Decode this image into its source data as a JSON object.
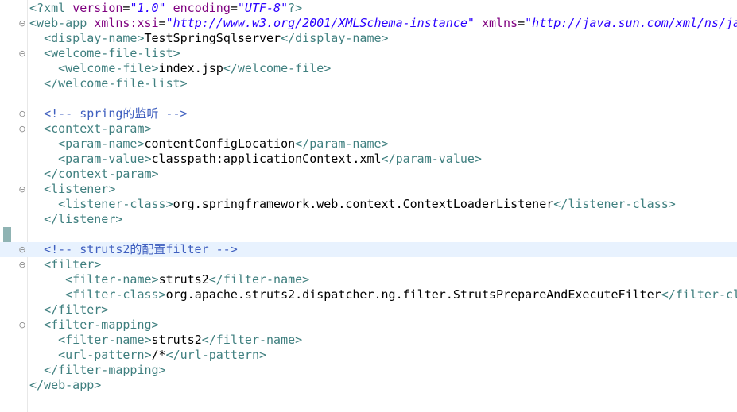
{
  "editor": {
    "lines": [
      [
        [
          "tag",
          "<?xml "
        ],
        [
          "attr",
          "version"
        ],
        [
          "txt",
          "="
        ],
        [
          "val",
          "\"1.0\""
        ],
        [
          "txt",
          " "
        ],
        [
          "attr",
          "encoding"
        ],
        [
          "txt",
          "="
        ],
        [
          "val",
          "\"UTF-8\""
        ],
        [
          "tag",
          "?>"
        ]
      ],
      [
        [
          "tag",
          "<web-app "
        ],
        [
          "attr",
          "xmlns:xsi"
        ],
        [
          "txt",
          "="
        ],
        [
          "val",
          "\"http://www.w3.org/2001/XMLSchema-instance\""
        ],
        [
          "txt",
          " "
        ],
        [
          "attr",
          "xmlns"
        ],
        [
          "txt",
          "="
        ],
        [
          "val",
          "\"http://java.sun.com/xml/ns/ja"
        ]
      ],
      [
        [
          "txt",
          "  "
        ],
        [
          "tag",
          "<display-name>"
        ],
        [
          "txt",
          "TestSpringSqlserver"
        ],
        [
          "tag",
          "</display-name>"
        ]
      ],
      [
        [
          "txt",
          "  "
        ],
        [
          "tag",
          "<welcome-file-list>"
        ]
      ],
      [
        [
          "txt",
          "    "
        ],
        [
          "tag",
          "<welcome-file>"
        ],
        [
          "txt",
          "index.jsp"
        ],
        [
          "tag",
          "</welcome-file>"
        ]
      ],
      [
        [
          "txt",
          "  "
        ],
        [
          "tag",
          "</welcome-file-list>"
        ]
      ],
      [],
      [
        [
          "txt",
          "  "
        ],
        [
          "cmt",
          "<!-- spring的监听 -->"
        ]
      ],
      [
        [
          "txt",
          "  "
        ],
        [
          "tag",
          "<context-param>"
        ]
      ],
      [
        [
          "txt",
          "    "
        ],
        [
          "tag",
          "<param-name>"
        ],
        [
          "txt",
          "contentConfigLocation"
        ],
        [
          "tag",
          "</param-name>"
        ]
      ],
      [
        [
          "txt",
          "    "
        ],
        [
          "tag",
          "<param-value>"
        ],
        [
          "txt",
          "classpath:applicationContext.xml"
        ],
        [
          "tag",
          "</param-value>"
        ]
      ],
      [
        [
          "txt",
          "  "
        ],
        [
          "tag",
          "</context-param>"
        ]
      ],
      [
        [
          "txt",
          "  "
        ],
        [
          "tag",
          "<listener>"
        ]
      ],
      [
        [
          "txt",
          "    "
        ],
        [
          "tag",
          "<listener-class>"
        ],
        [
          "txt",
          "org.springframework.web.context.ContextLoaderListener"
        ],
        [
          "tag",
          "</listener-class>"
        ]
      ],
      [
        [
          "txt",
          "  "
        ],
        [
          "tag",
          "</listener>"
        ]
      ],
      [],
      [
        [
          "txt",
          "  "
        ],
        [
          "cmt",
          "<!-- struts2的配置filter -->"
        ]
      ],
      [
        [
          "txt",
          "  "
        ],
        [
          "tag",
          "<filter>"
        ]
      ],
      [
        [
          "txt",
          "     "
        ],
        [
          "tag",
          "<filter-name>"
        ],
        [
          "txt",
          "struts2"
        ],
        [
          "tag",
          "</filter-name>"
        ]
      ],
      [
        [
          "txt",
          "     "
        ],
        [
          "tag",
          "<filter-class>"
        ],
        [
          "txt",
          "org.apache.struts2.dispatcher.ng.filter.StrutsPrepareAndExecuteFilter"
        ],
        [
          "tag",
          "</filter-cl"
        ]
      ],
      [
        [
          "txt",
          "  "
        ],
        [
          "tag",
          "</filter>"
        ]
      ],
      [
        [
          "txt",
          "  "
        ],
        [
          "tag",
          "<filter-mapping>"
        ]
      ],
      [
        [
          "txt",
          "    "
        ],
        [
          "tag",
          "<filter-name>"
        ],
        [
          "txt",
          "struts2"
        ],
        [
          "tag",
          "</filter-name>"
        ]
      ],
      [
        [
          "txt",
          "    "
        ],
        [
          "tag",
          "<url-pattern>"
        ],
        [
          "txt",
          "/*"
        ],
        [
          "tag",
          "</url-pattern>"
        ]
      ],
      [
        [
          "txt",
          "  "
        ],
        [
          "tag",
          "</filter-mapping>"
        ]
      ],
      [
        [
          "tag",
          "</web-app>"
        ]
      ]
    ],
    "fold_lines": [
      1,
      3,
      7,
      8,
      12,
      16,
      17,
      21
    ],
    "fold_glyph": "⊖",
    "current_line": 16,
    "change_marker_lines": [
      15,
      16
    ]
  }
}
